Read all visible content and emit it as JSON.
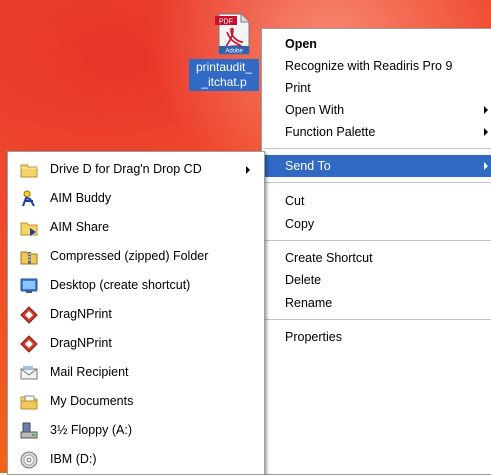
{
  "desktop_file": {
    "icon_text": "PDF",
    "icon_subtext": "Adobe",
    "label_line1": "printaudit_",
    "label_line2": "_itchat.p"
  },
  "context_menu": {
    "items": [
      {
        "label": "Open"
      },
      {
        "label": "Recognize with Readiris Pro 9"
      },
      {
        "label": "Print"
      },
      {
        "label": "Open With"
      },
      {
        "label": "Function Palette"
      },
      {
        "label": "Send To"
      },
      {
        "label": "Cut"
      },
      {
        "label": "Copy"
      },
      {
        "label": "Create Shortcut"
      },
      {
        "label": "Delete"
      },
      {
        "label": "Rename"
      },
      {
        "label": "Properties"
      }
    ]
  },
  "send_to_menu": {
    "items": [
      {
        "label": "Drive D for Drag'n Drop CD",
        "icon": "folder-icon"
      },
      {
        "label": "AIM Buddy",
        "icon": "aim-buddy-icon"
      },
      {
        "label": "AIM Share",
        "icon": "aim-share-icon"
      },
      {
        "label": "Compressed (zipped) Folder",
        "icon": "zipped-folder-icon"
      },
      {
        "label": "Desktop (create shortcut)",
        "icon": "desktop-icon"
      },
      {
        "label": "DragNPrint",
        "icon": "dragnprint-icon"
      },
      {
        "label": "DragNPrint",
        "icon": "dragnprint-icon"
      },
      {
        "label": "Mail Recipient",
        "icon": "mail-icon"
      },
      {
        "label": "My Documents",
        "icon": "my-documents-icon"
      },
      {
        "label": "3½ Floppy (A:)",
        "icon": "floppy-icon"
      },
      {
        "label": "IBM (D:)",
        "icon": "cd-drive-icon"
      }
    ]
  },
  "colors": {
    "selection": "#316ac5",
    "desktop_red": "#e8402c",
    "desktop_orange": "#f47a12"
  }
}
